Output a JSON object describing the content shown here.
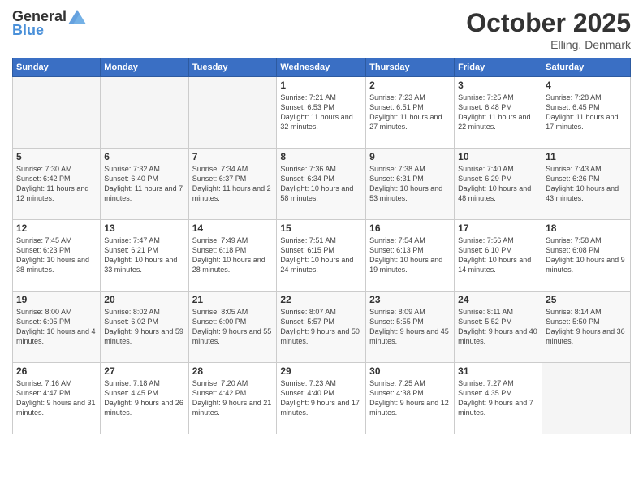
{
  "logo": {
    "general": "General",
    "blue": "Blue"
  },
  "header": {
    "title": "October 2025",
    "subtitle": "Elling, Denmark"
  },
  "weekdays": [
    "Sunday",
    "Monday",
    "Tuesday",
    "Wednesday",
    "Thursday",
    "Friday",
    "Saturday"
  ],
  "weeks": [
    [
      {
        "day": "",
        "sunrise": "",
        "sunset": "",
        "daylight": ""
      },
      {
        "day": "",
        "sunrise": "",
        "sunset": "",
        "daylight": ""
      },
      {
        "day": "",
        "sunrise": "",
        "sunset": "",
        "daylight": ""
      },
      {
        "day": "1",
        "sunrise": "Sunrise: 7:21 AM",
        "sunset": "Sunset: 6:53 PM",
        "daylight": "Daylight: 11 hours and 32 minutes."
      },
      {
        "day": "2",
        "sunrise": "Sunrise: 7:23 AM",
        "sunset": "Sunset: 6:51 PM",
        "daylight": "Daylight: 11 hours and 27 minutes."
      },
      {
        "day": "3",
        "sunrise": "Sunrise: 7:25 AM",
        "sunset": "Sunset: 6:48 PM",
        "daylight": "Daylight: 11 hours and 22 minutes."
      },
      {
        "day": "4",
        "sunrise": "Sunrise: 7:28 AM",
        "sunset": "Sunset: 6:45 PM",
        "daylight": "Daylight: 11 hours and 17 minutes."
      }
    ],
    [
      {
        "day": "5",
        "sunrise": "Sunrise: 7:30 AM",
        "sunset": "Sunset: 6:42 PM",
        "daylight": "Daylight: 11 hours and 12 minutes."
      },
      {
        "day": "6",
        "sunrise": "Sunrise: 7:32 AM",
        "sunset": "Sunset: 6:40 PM",
        "daylight": "Daylight: 11 hours and 7 minutes."
      },
      {
        "day": "7",
        "sunrise": "Sunrise: 7:34 AM",
        "sunset": "Sunset: 6:37 PM",
        "daylight": "Daylight: 11 hours and 2 minutes."
      },
      {
        "day": "8",
        "sunrise": "Sunrise: 7:36 AM",
        "sunset": "Sunset: 6:34 PM",
        "daylight": "Daylight: 10 hours and 58 minutes."
      },
      {
        "day": "9",
        "sunrise": "Sunrise: 7:38 AM",
        "sunset": "Sunset: 6:31 PM",
        "daylight": "Daylight: 10 hours and 53 minutes."
      },
      {
        "day": "10",
        "sunrise": "Sunrise: 7:40 AM",
        "sunset": "Sunset: 6:29 PM",
        "daylight": "Daylight: 10 hours and 48 minutes."
      },
      {
        "day": "11",
        "sunrise": "Sunrise: 7:43 AM",
        "sunset": "Sunset: 6:26 PM",
        "daylight": "Daylight: 10 hours and 43 minutes."
      }
    ],
    [
      {
        "day": "12",
        "sunrise": "Sunrise: 7:45 AM",
        "sunset": "Sunset: 6:23 PM",
        "daylight": "Daylight: 10 hours and 38 minutes."
      },
      {
        "day": "13",
        "sunrise": "Sunrise: 7:47 AM",
        "sunset": "Sunset: 6:21 PM",
        "daylight": "Daylight: 10 hours and 33 minutes."
      },
      {
        "day": "14",
        "sunrise": "Sunrise: 7:49 AM",
        "sunset": "Sunset: 6:18 PM",
        "daylight": "Daylight: 10 hours and 28 minutes."
      },
      {
        "day": "15",
        "sunrise": "Sunrise: 7:51 AM",
        "sunset": "Sunset: 6:15 PM",
        "daylight": "Daylight: 10 hours and 24 minutes."
      },
      {
        "day": "16",
        "sunrise": "Sunrise: 7:54 AM",
        "sunset": "Sunset: 6:13 PM",
        "daylight": "Daylight: 10 hours and 19 minutes."
      },
      {
        "day": "17",
        "sunrise": "Sunrise: 7:56 AM",
        "sunset": "Sunset: 6:10 PM",
        "daylight": "Daylight: 10 hours and 14 minutes."
      },
      {
        "day": "18",
        "sunrise": "Sunrise: 7:58 AM",
        "sunset": "Sunset: 6:08 PM",
        "daylight": "Daylight: 10 hours and 9 minutes."
      }
    ],
    [
      {
        "day": "19",
        "sunrise": "Sunrise: 8:00 AM",
        "sunset": "Sunset: 6:05 PM",
        "daylight": "Daylight: 10 hours and 4 minutes."
      },
      {
        "day": "20",
        "sunrise": "Sunrise: 8:02 AM",
        "sunset": "Sunset: 6:02 PM",
        "daylight": "Daylight: 9 hours and 59 minutes."
      },
      {
        "day": "21",
        "sunrise": "Sunrise: 8:05 AM",
        "sunset": "Sunset: 6:00 PM",
        "daylight": "Daylight: 9 hours and 55 minutes."
      },
      {
        "day": "22",
        "sunrise": "Sunrise: 8:07 AM",
        "sunset": "Sunset: 5:57 PM",
        "daylight": "Daylight: 9 hours and 50 minutes."
      },
      {
        "day": "23",
        "sunrise": "Sunrise: 8:09 AM",
        "sunset": "Sunset: 5:55 PM",
        "daylight": "Daylight: 9 hours and 45 minutes."
      },
      {
        "day": "24",
        "sunrise": "Sunrise: 8:11 AM",
        "sunset": "Sunset: 5:52 PM",
        "daylight": "Daylight: 9 hours and 40 minutes."
      },
      {
        "day": "25",
        "sunrise": "Sunrise: 8:14 AM",
        "sunset": "Sunset: 5:50 PM",
        "daylight": "Daylight: 9 hours and 36 minutes."
      }
    ],
    [
      {
        "day": "26",
        "sunrise": "Sunrise: 7:16 AM",
        "sunset": "Sunset: 4:47 PM",
        "daylight": "Daylight: 9 hours and 31 minutes."
      },
      {
        "day": "27",
        "sunrise": "Sunrise: 7:18 AM",
        "sunset": "Sunset: 4:45 PM",
        "daylight": "Daylight: 9 hours and 26 minutes."
      },
      {
        "day": "28",
        "sunrise": "Sunrise: 7:20 AM",
        "sunset": "Sunset: 4:42 PM",
        "daylight": "Daylight: 9 hours and 21 minutes."
      },
      {
        "day": "29",
        "sunrise": "Sunrise: 7:23 AM",
        "sunset": "Sunset: 4:40 PM",
        "daylight": "Daylight: 9 hours and 17 minutes."
      },
      {
        "day": "30",
        "sunrise": "Sunrise: 7:25 AM",
        "sunset": "Sunset: 4:38 PM",
        "daylight": "Daylight: 9 hours and 12 minutes."
      },
      {
        "day": "31",
        "sunrise": "Sunrise: 7:27 AM",
        "sunset": "Sunset: 4:35 PM",
        "daylight": "Daylight: 9 hours and 7 minutes."
      },
      {
        "day": "",
        "sunrise": "",
        "sunset": "",
        "daylight": ""
      }
    ]
  ]
}
